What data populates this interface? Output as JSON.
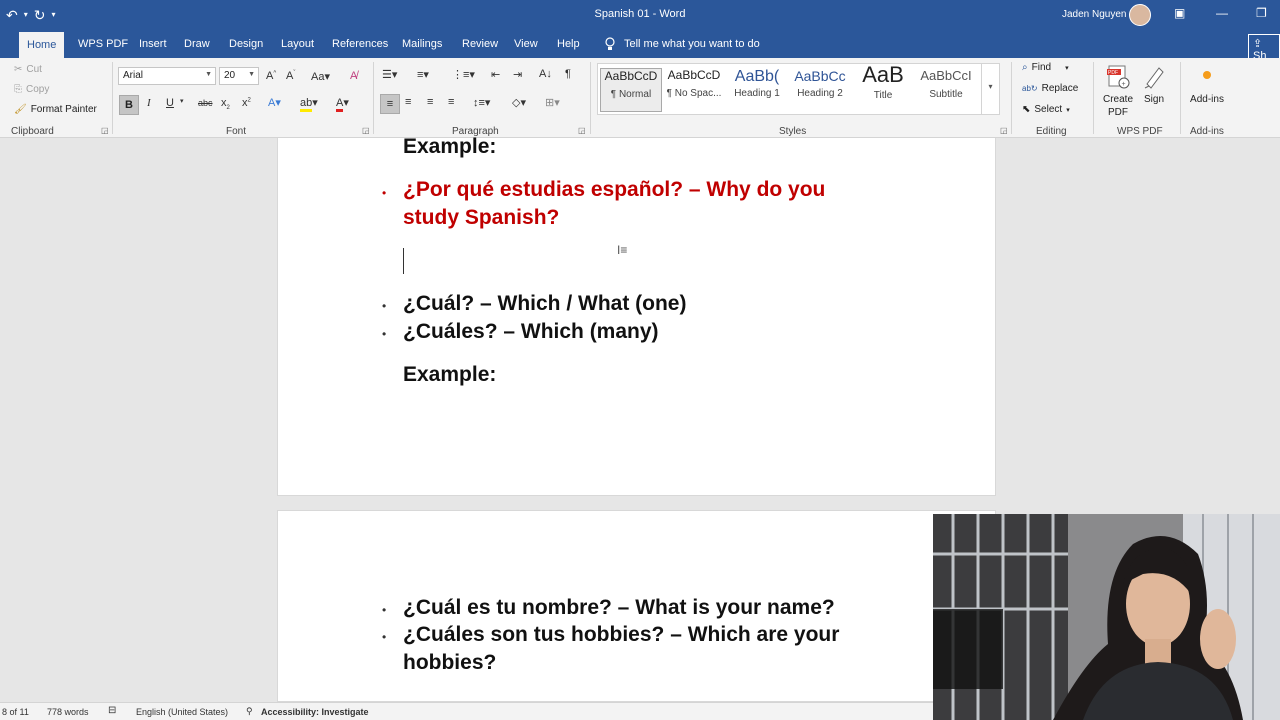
{
  "titlebar": {
    "doc_title": "Spanish 01  -  Word",
    "user_name": "Jaden Nguyen"
  },
  "tabs": [
    {
      "label": "Home",
      "active": true
    },
    {
      "label": "WPS PDF"
    },
    {
      "label": "Insert"
    },
    {
      "label": "Draw"
    },
    {
      "label": "Design"
    },
    {
      "label": "Layout"
    },
    {
      "label": "References"
    },
    {
      "label": "Mailings"
    },
    {
      "label": "Review"
    },
    {
      "label": "View"
    },
    {
      "label": "Help"
    }
  ],
  "tell_me": "Tell me what you want to do",
  "share_label": "Sh",
  "clipboard": {
    "cut": "Cut",
    "copy": "Copy",
    "format_painter": "Format Painter",
    "group_label": "Clipboard"
  },
  "font": {
    "family": "Arial",
    "size": "20",
    "group_label": "Font"
  },
  "paragraph": {
    "group_label": "Paragraph"
  },
  "styles": {
    "group_label": "Styles",
    "items": [
      {
        "preview": "AaBbCcD",
        "name": "¶ Normal"
      },
      {
        "preview": "AaBbCcD",
        "name": "¶ No Spac..."
      },
      {
        "preview": "AaBb(",
        "name": "Heading 1"
      },
      {
        "preview": "AaBbCc",
        "name": "Heading 2"
      },
      {
        "preview": "AaB",
        "name": "Title"
      },
      {
        "preview": "AaBbCcI",
        "name": "Subtitle"
      }
    ]
  },
  "editing": {
    "find": "Find",
    "replace": "Replace",
    "select": "Select",
    "group_label": "Editing"
  },
  "wps_pdf": {
    "create_pdf_line1": "Create",
    "create_pdf_line2": "PDF",
    "sign": "Sign",
    "group_label": "WPS PDF"
  },
  "addins": {
    "label": "Add-ins",
    "group_label": "Add-ins"
  },
  "document": {
    "page1": {
      "example_1": "Example:",
      "q_por_que": "¿Por qué estudias español? – Why do you",
      "q_por_que_cont": "study Spanish?",
      "cual": "¿Cuál? – Which / What (one)",
      "cuales": "¿Cuáles? – Which (many)",
      "example_2": "Example:"
    },
    "page2": {
      "cual_nombre": "¿Cuál es tu nombre? – What is your name?",
      "cuales_hobbies": "¿Cuáles son tus hobbies? – Which are your",
      "cuales_hobbies_cont": "hobbies?"
    }
  },
  "status": {
    "page": "8 of 11",
    "words": "778 words",
    "language": "English (United States)",
    "accessibility": "Accessibility: Investigate"
  }
}
